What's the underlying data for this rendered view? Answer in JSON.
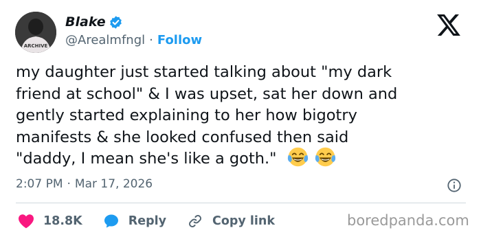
{
  "user": {
    "name": "Blake",
    "handle": "@Arealmfngl",
    "follow_label": "Follow",
    "separator": "·",
    "avatar_shirt_text": "ARCHIVE"
  },
  "tweet": {
    "lines": [
      "my daughter just started talking about \"my dark",
      "friend at school\" & I was upset, sat her down and",
      "gently started explaining to her how bigotry",
      "manifests & she looked confused then said",
      "\"daddy, I mean she's like a goth.\""
    ],
    "emoji": [
      "face-with-tears-of-joy",
      "face-with-tears-of-joy"
    ]
  },
  "meta": {
    "time": "2:07 PM",
    "separator": "·",
    "date": "Mar 17, 2026"
  },
  "actions": {
    "likes": "18.8K",
    "reply_label": "Reply",
    "copy_link_label": "Copy link"
  },
  "watermark": "boredpanda.com",
  "icons": {
    "verified": "verified-badge-icon",
    "x_logo": "x-logo-icon",
    "info": "info-icon",
    "heart": "heart-icon",
    "reply": "reply-bubble-icon",
    "link": "link-icon"
  },
  "colors": {
    "text": "#0f1419",
    "secondary": "#536471",
    "accent": "#1d9bf0",
    "like": "#f91880",
    "divider": "#cfd9de",
    "watermark": "#9a9a9a"
  }
}
